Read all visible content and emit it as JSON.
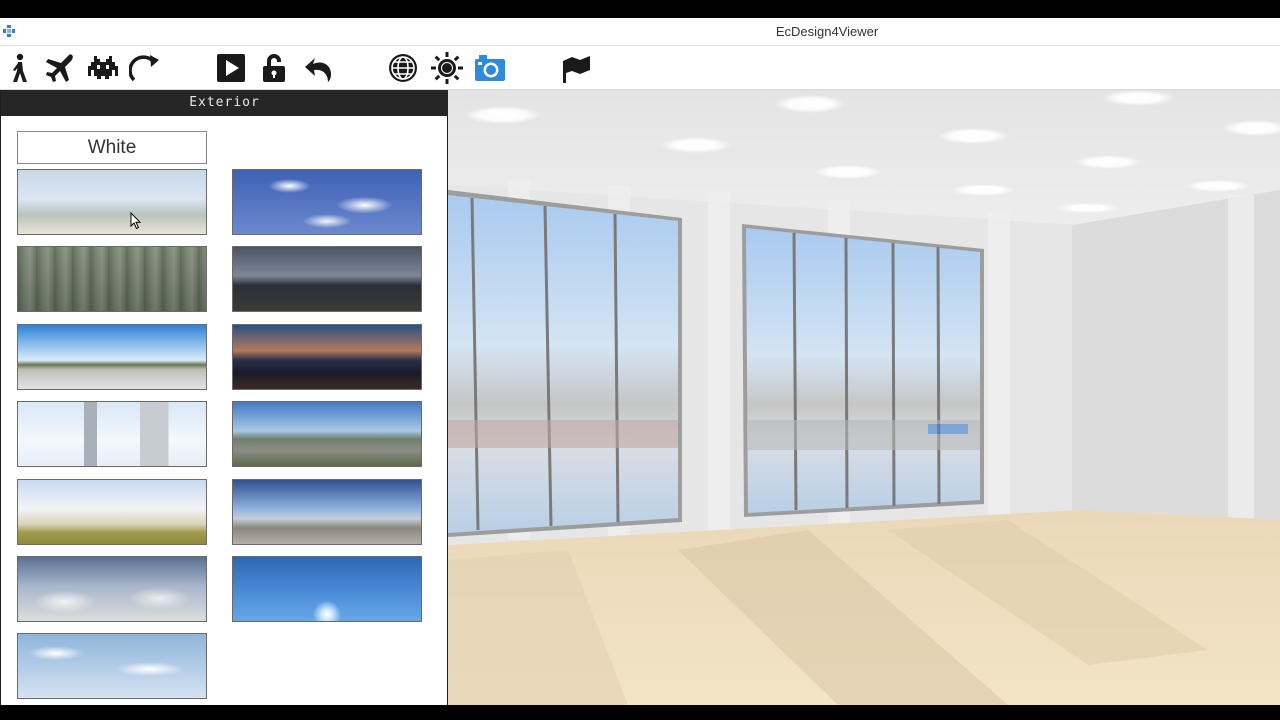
{
  "window": {
    "title": "EcDesign4Viewer"
  },
  "toolbar": {
    "buttons": [
      {
        "icon": "walk-icon",
        "label": "Walk"
      },
      {
        "icon": "airplane-icon",
        "label": "Fly"
      },
      {
        "icon": "invader-icon",
        "label": "Character"
      },
      {
        "icon": "rotate-icon",
        "label": "Rotate"
      },
      {
        "icon": "play-icon",
        "label": "Play"
      },
      {
        "icon": "lock-icon",
        "label": "Lock"
      },
      {
        "icon": "undo-icon",
        "label": "Undo"
      },
      {
        "icon": "globe-icon",
        "label": "Exterior"
      },
      {
        "icon": "sun-icon",
        "label": "Light"
      },
      {
        "icon": "camera-icon",
        "label": "Camera"
      },
      {
        "icon": "flag-icon",
        "label": "Flag"
      }
    ]
  },
  "panel": {
    "header": "Exterior",
    "white_label": "White",
    "thumbnails": [
      {
        "name": "beach-sky"
      },
      {
        "name": "blue-sky-clouds"
      },
      {
        "name": "forest"
      },
      {
        "name": "city-night-dusk"
      },
      {
        "name": "park-panorama"
      },
      {
        "name": "city-sunset-lights"
      },
      {
        "name": "city-towers"
      },
      {
        "name": "waterfront-road"
      },
      {
        "name": "field-horizon"
      },
      {
        "name": "harbor-panorama"
      },
      {
        "name": "cloudy-sky"
      },
      {
        "name": "sun-sky"
      },
      {
        "name": "light-clouds"
      }
    ]
  },
  "colors": {
    "titlebar_bg": "#ffffff",
    "panel_header_bg": "#262626",
    "toolbar_icon": "#1a1a1a",
    "camera_accent": "#2f8ad8"
  }
}
